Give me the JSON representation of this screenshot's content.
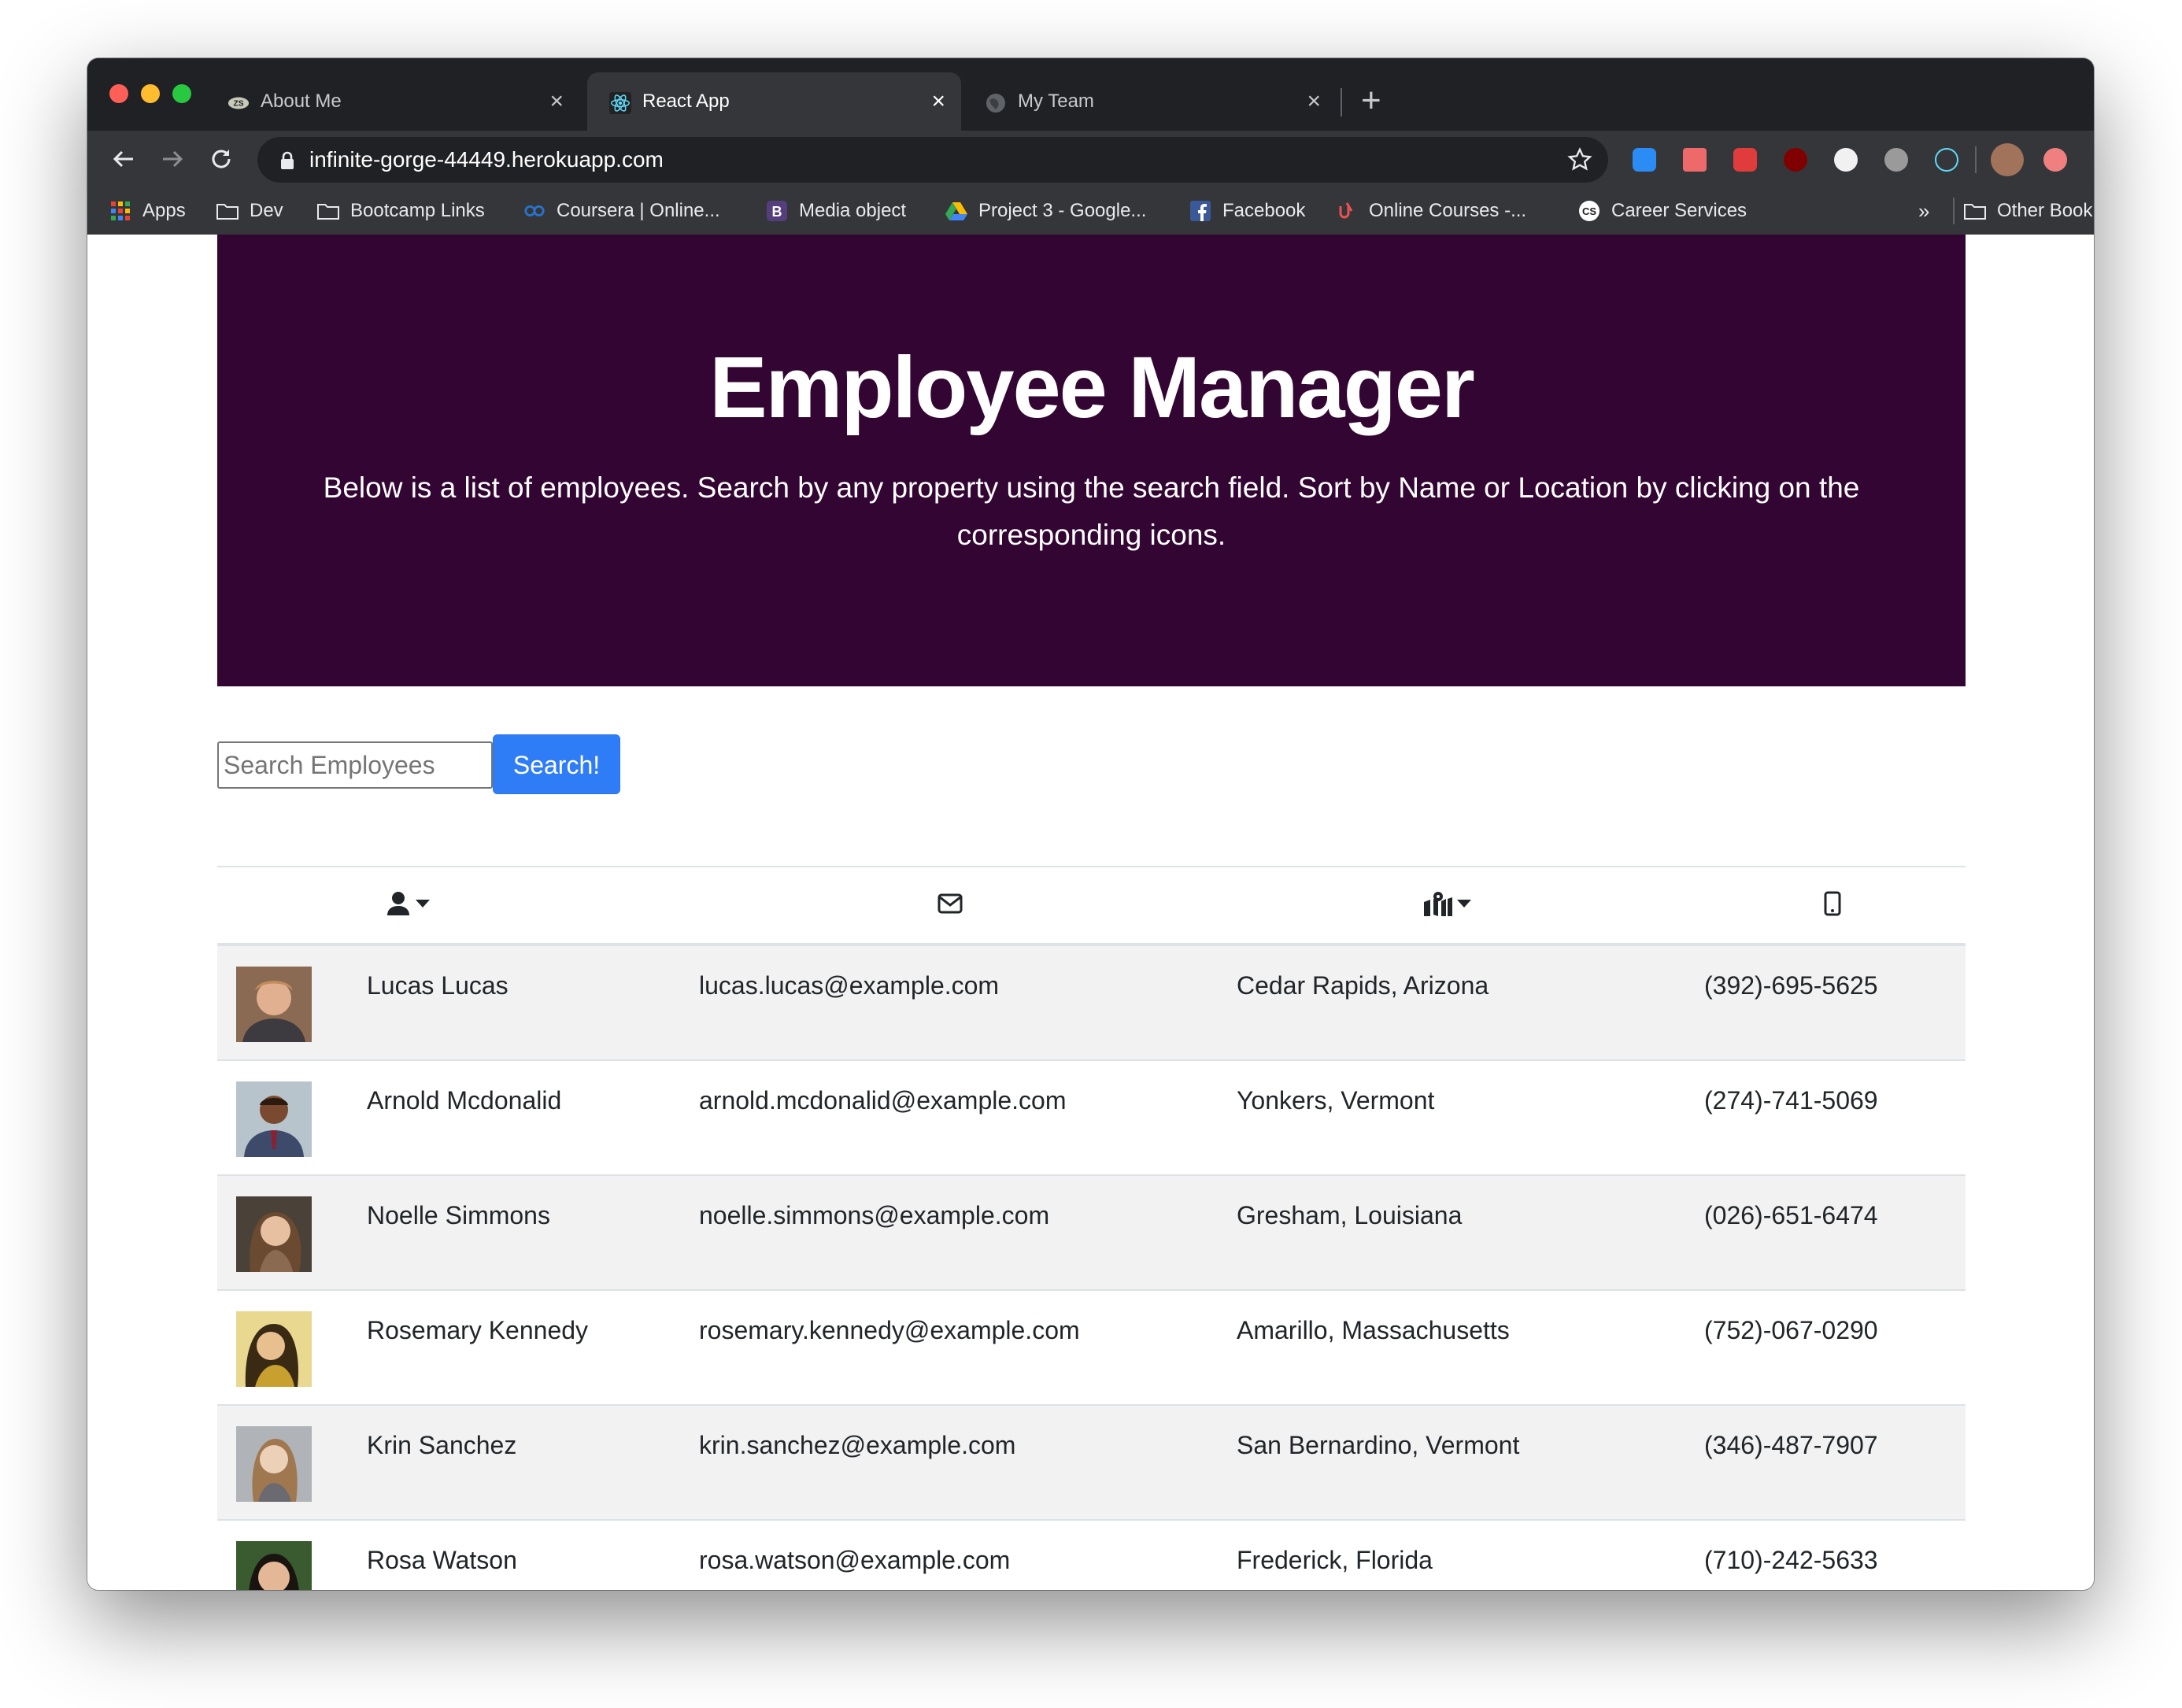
{
  "browser": {
    "tabs": [
      {
        "title": "About Me",
        "favicon": "zs-logo-icon",
        "active": false
      },
      {
        "title": "React App",
        "favicon": "react-icon",
        "active": true
      },
      {
        "title": "My Team",
        "favicon": "globe-icon",
        "active": false
      }
    ],
    "close_glyph": "×",
    "new_tab_glyph": "+",
    "url": "infinite-gorge-44449.herokuapp.com",
    "bookmarks": [
      {
        "label": "Apps",
        "icon": "apps-grid-icon"
      },
      {
        "label": "Dev",
        "icon": "folder-icon"
      },
      {
        "label": "Bootcamp Links",
        "icon": "folder-icon"
      },
      {
        "label": "Coursera | Online...",
        "icon": "coursera-icon"
      },
      {
        "label": "Media object",
        "icon": "bootstrap-icon"
      },
      {
        "label": "Project 3 - Google...",
        "icon": "google-drive-icon"
      },
      {
        "label": "Facebook",
        "icon": "facebook-icon"
      },
      {
        "label": "Online Courses -...",
        "icon": "udemy-icon"
      },
      {
        "label": "Career Services",
        "icon": "career-services-icon"
      }
    ],
    "bookmarks_overflow": "»",
    "other_bookmarks": "Other Bookmarks"
  },
  "page": {
    "title": "Employee Manager",
    "subtitle": "Below is a list of employees. Search by any property using the search field. Sort by Name or Location by clicking on the corresponding icons.",
    "search": {
      "placeholder": "Search Employees",
      "value": "",
      "button_label": "Search!"
    },
    "columns": [
      {
        "key": "image",
        "icon": ""
      },
      {
        "key": "name",
        "icon": "user-icon",
        "sortable": true
      },
      {
        "key": "email",
        "icon": "envelope-icon",
        "sortable": false
      },
      {
        "key": "location",
        "icon": "map-marked-icon",
        "sortable": true
      },
      {
        "key": "phone",
        "icon": "mobile-phone-icon",
        "sortable": false
      }
    ],
    "employees": [
      {
        "name": "Lucas Lucas",
        "email": "lucas.lucas@example.com",
        "location": "Cedar Rapids, Arizona",
        "phone": "(392)-695-5625"
      },
      {
        "name": "Arnold Mcdonalid",
        "email": "arnold.mcdonalid@example.com",
        "location": "Yonkers, Vermont",
        "phone": "(274)-741-5069"
      },
      {
        "name": "Noelle Simmons",
        "email": "noelle.simmons@example.com",
        "location": "Gresham, Louisiana",
        "phone": "(026)-651-6474"
      },
      {
        "name": "Rosemary Kennedy",
        "email": "rosemary.kennedy@example.com",
        "location": "Amarillo, Massachusetts",
        "phone": "(752)-067-0290"
      },
      {
        "name": "Krin Sanchez",
        "email": "krin.sanchez@example.com",
        "location": "San Bernardino, Vermont",
        "phone": "(346)-487-7907"
      },
      {
        "name": "Rosa Watson",
        "email": "rosa.watson@example.com",
        "location": "Frederick, Florida",
        "phone": "(710)-242-5633"
      }
    ]
  },
  "colors": {
    "jumbotron_bg": "#330533",
    "primary_button": "#2f7df6",
    "striped_row": "#f2f2f2",
    "chrome_dark": "#202124",
    "chrome_toolbar": "#35363a"
  }
}
